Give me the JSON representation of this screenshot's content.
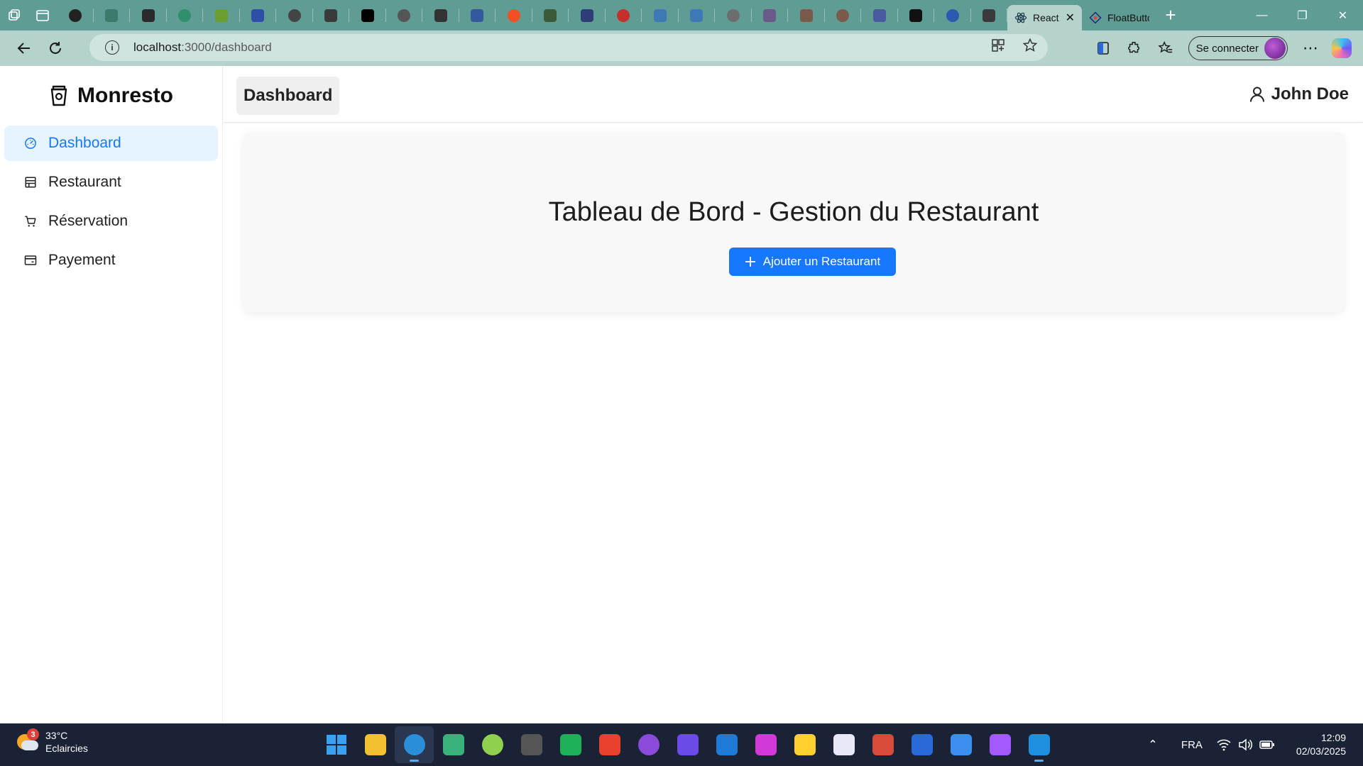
{
  "browser": {
    "pinned_tabs": [
      {
        "icon": "openai-icon",
        "color": "#222222"
      },
      {
        "icon": "webflow-icon",
        "color": "#3d7a6e"
      },
      {
        "icon": "terminal-icon",
        "color": "#2a2a2a"
      },
      {
        "icon": "globe-green-icon",
        "color": "#2f8f6a"
      },
      {
        "icon": "green-app-icon",
        "color": "#6a9e2e"
      },
      {
        "icon": "chart-icon",
        "color": "#2d4fa8"
      },
      {
        "icon": "image-icon",
        "color": "#444444"
      },
      {
        "icon": "circle-dark-icon",
        "color": "#3a3a3a"
      },
      {
        "icon": "bold-b-icon",
        "color": "#000000"
      },
      {
        "icon": "shield-icon",
        "color": "#555555"
      },
      {
        "icon": "sliders-icon",
        "color": "#333333"
      },
      {
        "icon": "cursive-icon",
        "color": "#34589e"
      },
      {
        "icon": "microsoft-icon",
        "color": "#f25022"
      },
      {
        "icon": "cube-icon",
        "color": "#3a5a3a"
      },
      {
        "icon": "hexagon-icon",
        "color": "#2c3e75"
      },
      {
        "icon": "youtube-icon",
        "color": "#c4302b"
      },
      {
        "icon": "react-blue-icon",
        "color": "#3d7ab5"
      },
      {
        "icon": "react-blue-icon",
        "color": "#3d7ab5"
      },
      {
        "icon": "record-icon",
        "color": "#6d6d6d"
      },
      {
        "icon": "play-icon",
        "color": "#6a5a8a"
      },
      {
        "icon": "photo-icon",
        "color": "#7a5a4a"
      },
      {
        "icon": "photo-icon",
        "color": "#7a5a4a"
      },
      {
        "icon": "monitor-icon",
        "color": "#4a5aa0"
      },
      {
        "icon": "github-icon",
        "color": "#111111"
      },
      {
        "icon": "blue-blob-icon",
        "color": "#2a5ab0"
      },
      {
        "icon": "caption-icon",
        "color": "#3a3a3a"
      }
    ],
    "open_tabs": [
      {
        "title": "React",
        "active": true
      },
      {
        "title": "FloatButton",
        "active": false
      }
    ],
    "url_host": "localhost",
    "url_path": ":3000/dashboard",
    "signin_label": "Se connecter"
  },
  "app": {
    "brand": "Monresto",
    "menu": [
      {
        "label": "Dashboard",
        "icon": "dashboard-icon",
        "selected": true
      },
      {
        "label": "Restaurant",
        "icon": "shop-icon",
        "selected": false
      },
      {
        "label": "Réservation",
        "icon": "cart-icon",
        "selected": false
      },
      {
        "label": "Payement",
        "icon": "credit-card-icon",
        "selected": false
      }
    ],
    "header_title": "Dashboard",
    "user_name": "John Doe",
    "card_title": "Tableau de Bord - Gestion du Restaurant",
    "add_button_label": "Ajouter un Restaurant",
    "accent_color": "#1677ff"
  },
  "taskbar": {
    "weather_badge": "3",
    "temperature": "33°C",
    "weather_text": "Eclaircies",
    "apps": [
      {
        "icon": "windows-start-icon",
        "color": "#3aa0f0"
      },
      {
        "icon": "file-explorer-icon",
        "color": "#f2c031"
      },
      {
        "icon": "edge-icon",
        "color": "#2a8fd8"
      },
      {
        "icon": "diamond-app-icon",
        "color": "#3ab07a"
      },
      {
        "icon": "cloud-app-icon",
        "color": "#8fd14f"
      },
      {
        "icon": "brawlhalla-icon",
        "color": "#555555"
      },
      {
        "icon": "green-app-icon",
        "color": "#1fb05a"
      },
      {
        "icon": "wps-icon",
        "color": "#e8412c"
      },
      {
        "icon": "github-desktop-icon",
        "color": "#8a4bd8"
      },
      {
        "icon": "purple-app-icon",
        "color": "#6a4be8"
      },
      {
        "icon": "trello-icon",
        "color": "#1f7ad8"
      },
      {
        "icon": "magenta-app-icon",
        "color": "#d23ad8"
      },
      {
        "icon": "miro-icon",
        "color": "#ffd02f"
      },
      {
        "icon": "gem-app-icon",
        "color": "#e8e8f8"
      },
      {
        "icon": "face-app-icon",
        "color": "#d84a3a"
      },
      {
        "icon": "whiteboard-icon",
        "color": "#2a6ad8"
      },
      {
        "icon": "todo-icon",
        "color": "#3a8ff0"
      },
      {
        "icon": "figma-icon",
        "color": "#a259ff"
      },
      {
        "icon": "vscode-icon",
        "color": "#1f8fe0"
      }
    ],
    "language": "FRA",
    "time": "12:09",
    "date": "02/03/2025"
  }
}
